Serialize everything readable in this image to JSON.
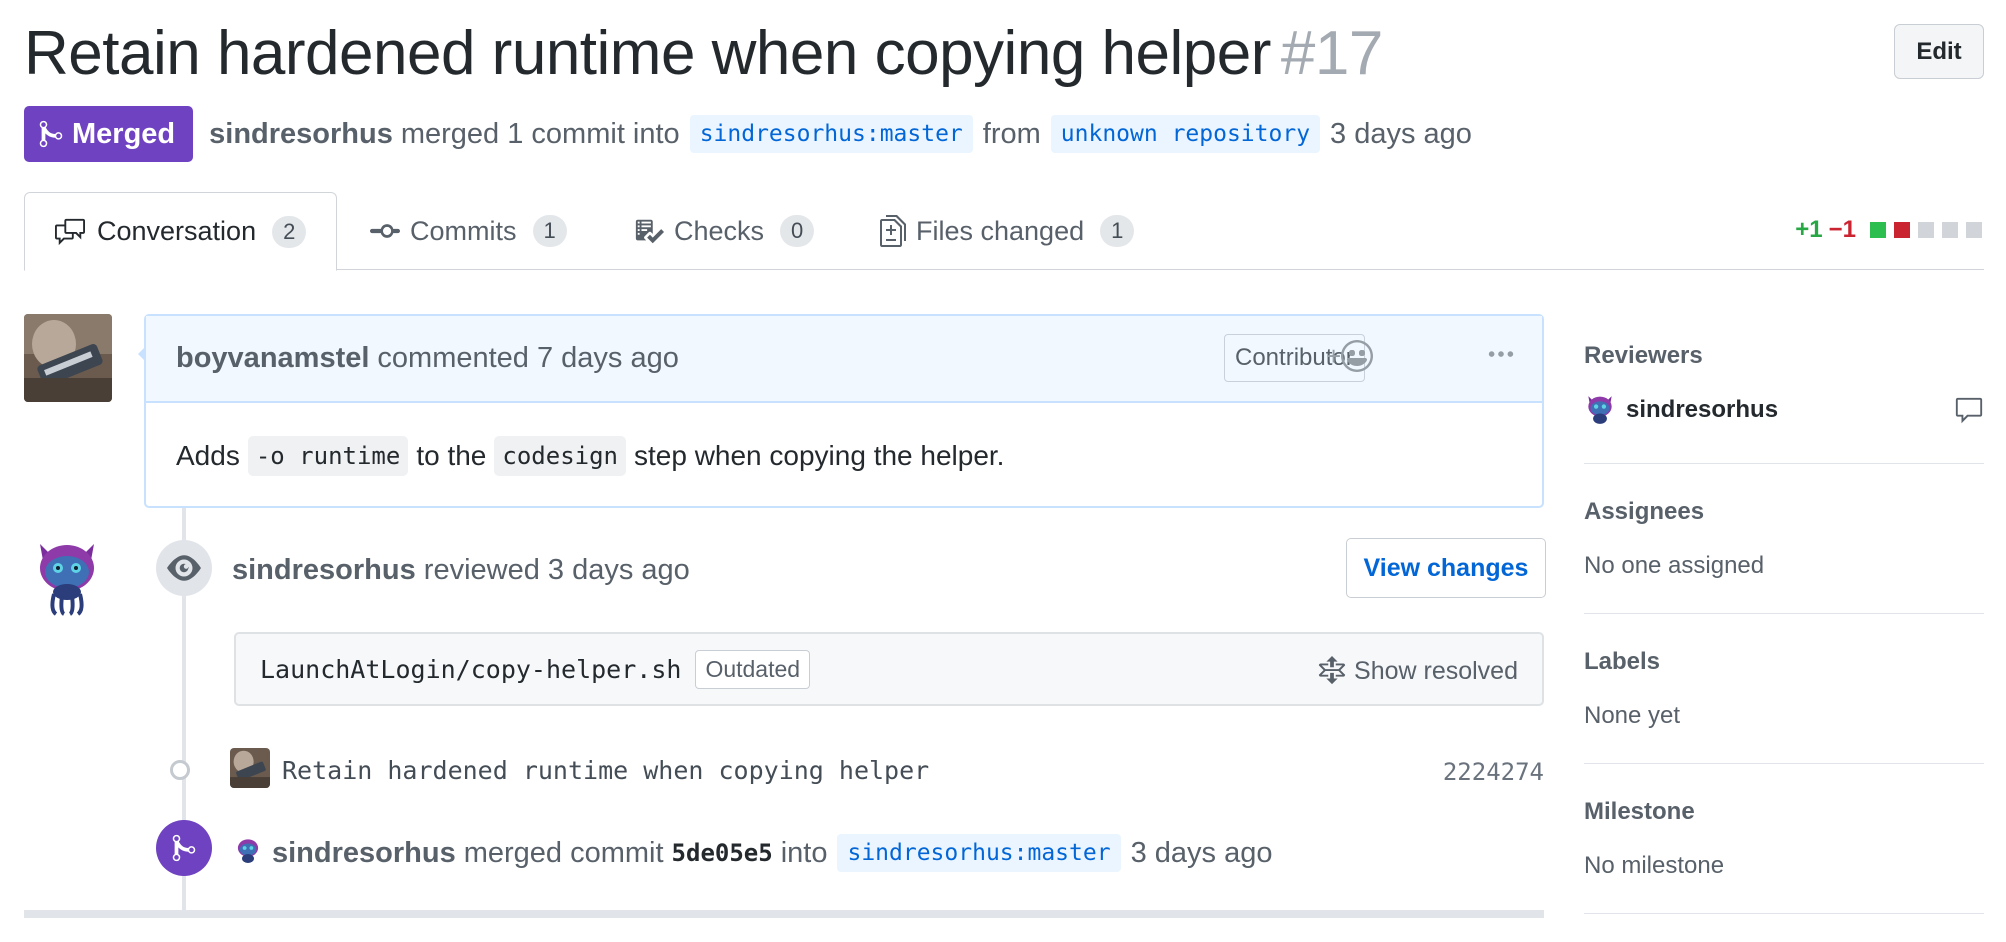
{
  "header": {
    "title": "Retain hardened runtime when copying helper",
    "number": "#17",
    "edit_label": "Edit",
    "state": "Merged",
    "author": "sindresorhus",
    "merge_text": "merged 1 commit into",
    "base_branch": "sindresorhus:master",
    "from_text": "from",
    "head_branch": "unknown repository",
    "time": "3 days ago"
  },
  "tabs": [
    {
      "label": "Conversation",
      "count": "2",
      "icon": "comment-discussion-icon"
    },
    {
      "label": "Commits",
      "count": "1",
      "icon": "git-commit-icon"
    },
    {
      "label": "Checks",
      "count": "0",
      "icon": "checklist-icon"
    },
    {
      "label": "Files changed",
      "count": "1",
      "icon": "file-diff-icon"
    }
  ],
  "diffstat": {
    "additions": "+1",
    "deletions": "−1",
    "colors": [
      "#2cbe4e",
      "#cb2431",
      "#d1d5da",
      "#d1d5da",
      "#d1d5da"
    ]
  },
  "comment": {
    "author": "boyvanamstel",
    "action": "commented 7 days ago",
    "badge": "Contributor",
    "reaction_plus": "+",
    "body_pre": "Adds",
    "code1": "-o runtime",
    "body_mid": "to the",
    "code2": "codesign",
    "body_post": "step when copying the helper."
  },
  "review": {
    "author": "sindresorhus",
    "action": "reviewed 3 days ago",
    "button": "View changes",
    "file": "LaunchAtLogin/copy-helper.sh",
    "outdated": "Outdated",
    "show_resolved": "Show resolved"
  },
  "commit": {
    "message": "Retain hardened runtime when copying helper",
    "sha": "2224274"
  },
  "merge_event": {
    "author": "sindresorhus",
    "text1": "merged commit",
    "sha": "5de05e5",
    "text2": "into",
    "branch": "sindresorhus:master",
    "time": "3 days ago"
  },
  "sidebar": {
    "reviewers_title": "Reviewers",
    "reviewer": "sindresorhus",
    "assignees_title": "Assignees",
    "assignees_value": "No one assigned",
    "labels_title": "Labels",
    "labels_value": "None yet",
    "milestone_title": "Milestone",
    "milestone_value": "No milestone"
  },
  "colors": {
    "merged": "#6f42c1",
    "link": "#0366d6",
    "branch_bg": "#eaf5ff",
    "comment_border": "#c8e1ff"
  }
}
